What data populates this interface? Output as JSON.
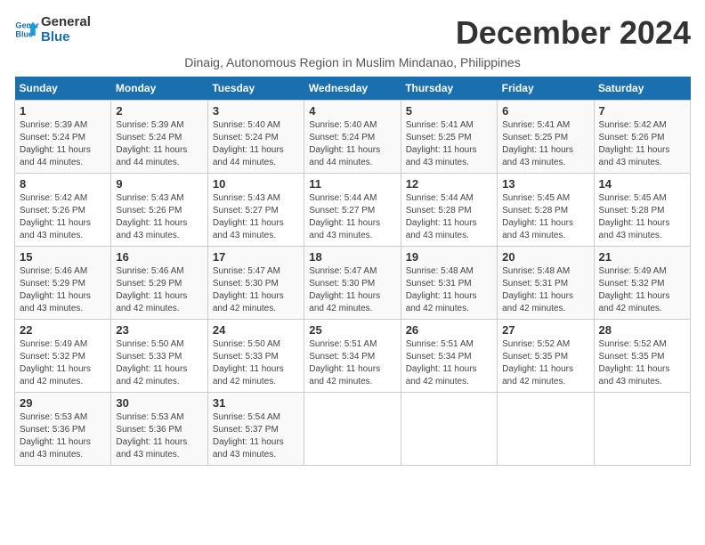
{
  "logo": {
    "line1": "General",
    "line2": "Blue"
  },
  "title": "December 2024",
  "subtitle": "Dinaig, Autonomous Region in Muslim Mindanao, Philippines",
  "headers": [
    "Sunday",
    "Monday",
    "Tuesday",
    "Wednesday",
    "Thursday",
    "Friday",
    "Saturday"
  ],
  "weeks": [
    [
      {
        "day": "1",
        "info": "Sunrise: 5:39 AM\nSunset: 5:24 PM\nDaylight: 11 hours\nand 44 minutes."
      },
      {
        "day": "2",
        "info": "Sunrise: 5:39 AM\nSunset: 5:24 PM\nDaylight: 11 hours\nand 44 minutes."
      },
      {
        "day": "3",
        "info": "Sunrise: 5:40 AM\nSunset: 5:24 PM\nDaylight: 11 hours\nand 44 minutes."
      },
      {
        "day": "4",
        "info": "Sunrise: 5:40 AM\nSunset: 5:24 PM\nDaylight: 11 hours\nand 44 minutes."
      },
      {
        "day": "5",
        "info": "Sunrise: 5:41 AM\nSunset: 5:25 PM\nDaylight: 11 hours\nand 43 minutes."
      },
      {
        "day": "6",
        "info": "Sunrise: 5:41 AM\nSunset: 5:25 PM\nDaylight: 11 hours\nand 43 minutes."
      },
      {
        "day": "7",
        "info": "Sunrise: 5:42 AM\nSunset: 5:26 PM\nDaylight: 11 hours\nand 43 minutes."
      }
    ],
    [
      {
        "day": "8",
        "info": "Sunrise: 5:42 AM\nSunset: 5:26 PM\nDaylight: 11 hours\nand 43 minutes."
      },
      {
        "day": "9",
        "info": "Sunrise: 5:43 AM\nSunset: 5:26 PM\nDaylight: 11 hours\nand 43 minutes."
      },
      {
        "day": "10",
        "info": "Sunrise: 5:43 AM\nSunset: 5:27 PM\nDaylight: 11 hours\nand 43 minutes."
      },
      {
        "day": "11",
        "info": "Sunrise: 5:44 AM\nSunset: 5:27 PM\nDaylight: 11 hours\nand 43 minutes."
      },
      {
        "day": "12",
        "info": "Sunrise: 5:44 AM\nSunset: 5:28 PM\nDaylight: 11 hours\nand 43 minutes."
      },
      {
        "day": "13",
        "info": "Sunrise: 5:45 AM\nSunset: 5:28 PM\nDaylight: 11 hours\nand 43 minutes."
      },
      {
        "day": "14",
        "info": "Sunrise: 5:45 AM\nSunset: 5:28 PM\nDaylight: 11 hours\nand 43 minutes."
      }
    ],
    [
      {
        "day": "15",
        "info": "Sunrise: 5:46 AM\nSunset: 5:29 PM\nDaylight: 11 hours\nand 43 minutes."
      },
      {
        "day": "16",
        "info": "Sunrise: 5:46 AM\nSunset: 5:29 PM\nDaylight: 11 hours\nand 42 minutes."
      },
      {
        "day": "17",
        "info": "Sunrise: 5:47 AM\nSunset: 5:30 PM\nDaylight: 11 hours\nand 42 minutes."
      },
      {
        "day": "18",
        "info": "Sunrise: 5:47 AM\nSunset: 5:30 PM\nDaylight: 11 hours\nand 42 minutes."
      },
      {
        "day": "19",
        "info": "Sunrise: 5:48 AM\nSunset: 5:31 PM\nDaylight: 11 hours\nand 42 minutes."
      },
      {
        "day": "20",
        "info": "Sunrise: 5:48 AM\nSunset: 5:31 PM\nDaylight: 11 hours\nand 42 minutes."
      },
      {
        "day": "21",
        "info": "Sunrise: 5:49 AM\nSunset: 5:32 PM\nDaylight: 11 hours\nand 42 minutes."
      }
    ],
    [
      {
        "day": "22",
        "info": "Sunrise: 5:49 AM\nSunset: 5:32 PM\nDaylight: 11 hours\nand 42 minutes."
      },
      {
        "day": "23",
        "info": "Sunrise: 5:50 AM\nSunset: 5:33 PM\nDaylight: 11 hours\nand 42 minutes."
      },
      {
        "day": "24",
        "info": "Sunrise: 5:50 AM\nSunset: 5:33 PM\nDaylight: 11 hours\nand 42 minutes."
      },
      {
        "day": "25",
        "info": "Sunrise: 5:51 AM\nSunset: 5:34 PM\nDaylight: 11 hours\nand 42 minutes."
      },
      {
        "day": "26",
        "info": "Sunrise: 5:51 AM\nSunset: 5:34 PM\nDaylight: 11 hours\nand 42 minutes."
      },
      {
        "day": "27",
        "info": "Sunrise: 5:52 AM\nSunset: 5:35 PM\nDaylight: 11 hours\nand 42 minutes."
      },
      {
        "day": "28",
        "info": "Sunrise: 5:52 AM\nSunset: 5:35 PM\nDaylight: 11 hours\nand 43 minutes."
      }
    ],
    [
      {
        "day": "29",
        "info": "Sunrise: 5:53 AM\nSunset: 5:36 PM\nDaylight: 11 hours\nand 43 minutes."
      },
      {
        "day": "30",
        "info": "Sunrise: 5:53 AM\nSunset: 5:36 PM\nDaylight: 11 hours\nand 43 minutes."
      },
      {
        "day": "31",
        "info": "Sunrise: 5:54 AM\nSunset: 5:37 PM\nDaylight: 11 hours\nand 43 minutes."
      },
      {
        "day": "",
        "info": ""
      },
      {
        "day": "",
        "info": ""
      },
      {
        "day": "",
        "info": ""
      },
      {
        "day": "",
        "info": ""
      }
    ]
  ]
}
